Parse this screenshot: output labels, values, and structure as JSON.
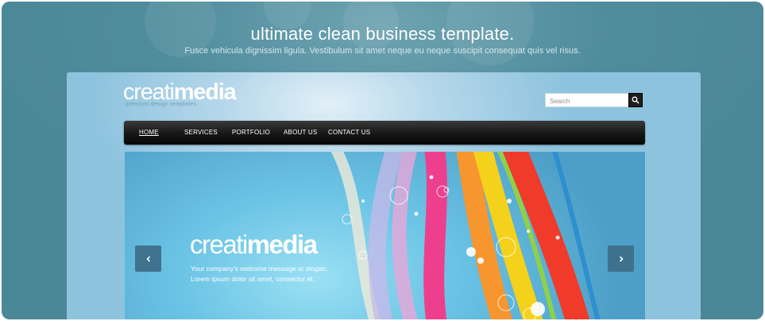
{
  "promo": {
    "title": "ultimate clean business template.",
    "subtitle": "Fusce vehicula dignissim ligula. Vestibulum sit amet neque eu neque suscipit consequat quis vel risus."
  },
  "site": {
    "logo_light": "creati",
    "logo_bold": "media",
    "tagline": "premium design templates",
    "search": {
      "placeholder": "Search"
    },
    "nav": [
      "HOME",
      "SERVICES",
      "PORTFOLIO",
      "ABOUT US",
      "CONTACT US"
    ],
    "active_nav": "HOME"
  },
  "slider": {
    "logo_light": "creati",
    "logo_bold": "media",
    "message_line1": "Your company's welcome message or slogan.",
    "message_line2": "Lorem ipsum dolor sit amet, consectur el.",
    "colors": {
      "red": "#f03a2a",
      "yellow": "#f4d21c",
      "magenta": "#ee3f8e",
      "orange": "#f7962e",
      "accent": "#3f6f8a"
    }
  },
  "icons": {
    "search": "magnifier-icon",
    "prev": "chevron-left-icon",
    "next": "chevron-right-icon"
  }
}
